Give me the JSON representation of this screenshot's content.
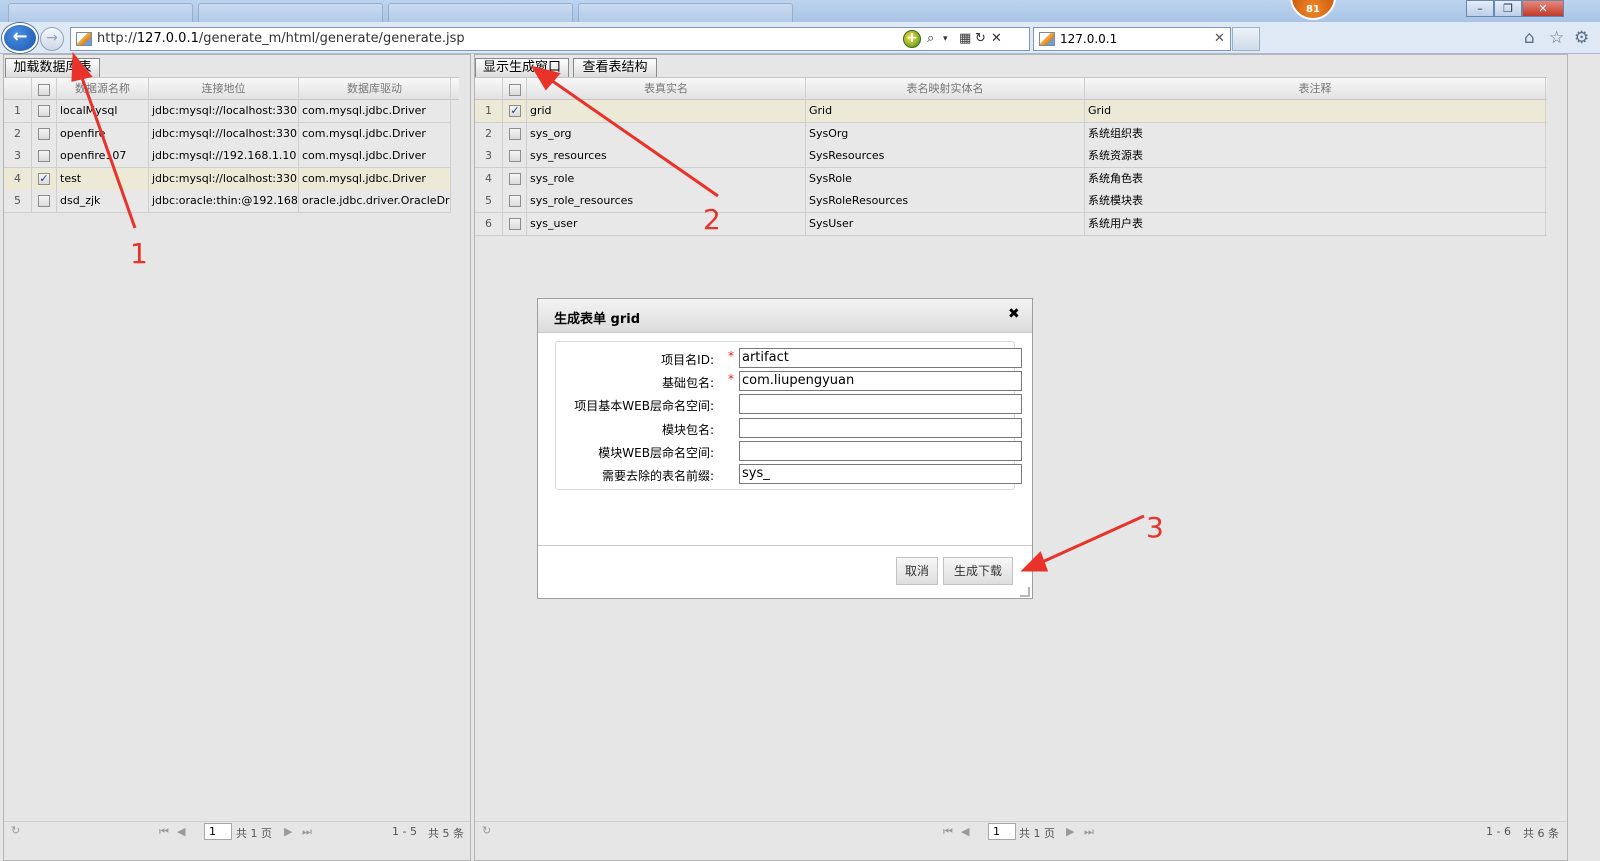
{
  "browser": {
    "url_prefix": "http://",
    "url_host": "127.0.0.1",
    "url_path": "/generate_m/html/generate/generate.jsp",
    "tab_title": "127.0.0.1",
    "notification_badge": "81"
  },
  "left_panel": {
    "load_button": "加载数据库表",
    "headers": [
      "数据源名称",
      "连接地位",
      "数据库驱动"
    ],
    "rows": [
      {
        "num": "1",
        "name": "localMysql",
        "url": "jdbc:mysql://localhost:330",
        "driver": "com.mysql.jdbc.Driver",
        "checked": false
      },
      {
        "num": "2",
        "name": "openfire",
        "url": "jdbc:mysql://localhost:330",
        "driver": "com.mysql.jdbc.Driver",
        "checked": false
      },
      {
        "num": "3",
        "name": "openfire107",
        "url": "jdbc:mysql://192.168.1.10",
        "driver": "com.mysql.jdbc.Driver",
        "checked": false
      },
      {
        "num": "4",
        "name": "test",
        "url": "jdbc:mysql://localhost:330",
        "driver": "com.mysql.jdbc.Driver",
        "checked": true
      },
      {
        "num": "5",
        "name": "dsd_zjk",
        "url": "jdbc:oracle:thin:@192.168",
        "driver": "oracle.jdbc.driver.OracleDri",
        "checked": false
      }
    ],
    "pager": {
      "page": "1",
      "total_pages": "共 1 页",
      "range": "1 - 5",
      "total": "共 5 条"
    }
  },
  "right_panel": {
    "show_button": "显示生成窗口",
    "view_button": "查看表结构",
    "headers": [
      "表真实名",
      "表名映射实体名",
      "表注释"
    ],
    "rows": [
      {
        "num": "1",
        "table": "grid",
        "entity": "Grid",
        "comment": "Grid",
        "checked": true
      },
      {
        "num": "2",
        "table": "sys_org",
        "entity": "SysOrg",
        "comment": "系统组织表",
        "checked": false
      },
      {
        "num": "3",
        "table": "sys_resources",
        "entity": "SysResources",
        "comment": "系统资源表",
        "checked": false
      },
      {
        "num": "4",
        "table": "sys_role",
        "entity": "SysRole",
        "comment": "系统角色表",
        "checked": false
      },
      {
        "num": "5",
        "table": "sys_role_resources",
        "entity": "SysRoleResources",
        "comment": "系统模块表",
        "checked": false
      },
      {
        "num": "6",
        "table": "sys_user",
        "entity": "SysUser",
        "comment": "系统用户表",
        "checked": false
      }
    ],
    "pager": {
      "page": "1",
      "total_pages": "共 1 页",
      "range": "1 - 6",
      "total": "共 6 条"
    }
  },
  "dialog": {
    "title": "生成表单 grid",
    "fields": [
      {
        "label": "项目名ID:",
        "value": "artifact",
        "required": true
      },
      {
        "label": "基础包名:",
        "value": "com.liupengyuan",
        "required": true
      },
      {
        "label": "项目基本WEB层命名空间:",
        "value": "",
        "required": false
      },
      {
        "label": "模块包名:",
        "value": "",
        "required": false
      },
      {
        "label": "模块WEB层命名空间:",
        "value": "",
        "required": false
      },
      {
        "label": "需要去除的表名前缀:",
        "value": "sys_",
        "required": false
      }
    ],
    "cancel": "取消",
    "generate": "生成下载"
  },
  "annotations": [
    "1",
    "2",
    "3"
  ],
  "colors": {
    "annotation": "#e8322a",
    "selected_row": "#ece9d6",
    "required": "#e02020"
  }
}
